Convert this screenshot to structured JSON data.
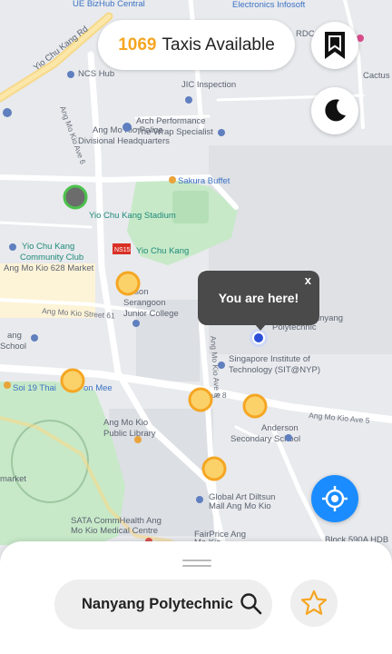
{
  "header": {
    "taxi_count": "1069",
    "taxi_label": "Taxis Available"
  },
  "map": {
    "labels": {
      "bizhub": "UE BizHub Central",
      "electronics": "Electronics Infosoft",
      "yio_chu_kang_rd": "Yio Chu Kang Rd",
      "rdc": "RDC-R",
      "ncs_hub": "NCS Hub",
      "jic": "JIC Inspection",
      "cactus": "Cactus Dr",
      "ang_mo_kio_ave_6": "Ang Mo Kio Ave 6",
      "arch_perf_1": "Arch Performance",
      "arch_perf_2": "The Wrap Specialist",
      "police_1": "Ang Mo Kio Police",
      "police_2": "Divisional Headquarters",
      "sakura": "Sakura Buffet",
      "stadium": "Yio Chu Kang Stadium",
      "cc_1": "Yio Chu Kang",
      "cc_2": "Community Club",
      "mrt_code": "NS15",
      "mrt_name": "Yio Chu Kang",
      "market_628": "Ang Mo Kio 628 Market",
      "serangoon_1": "rson",
      "serangoon_2": "Serangoon",
      "serangoon_3": "Junior College",
      "street_61": "Ang Mo Kio Street 61",
      "school_1": "ang",
      "school_2": "School",
      "nanyang_1": "Nanyang",
      "nanyang_2": "Polytechnic",
      "ave_8": "Ang Mo Kio Ave 8",
      "sit_1": "Singapore Institute of",
      "sit_2": "Technology (SIT@NYP)",
      "soi19_1": "Soi 19 Thai",
      "soi19_2": "on Mee",
      "ave8_short": "ue 8",
      "ave5": "Ang Mo Kio Ave 5",
      "anderson_1": "Anderson",
      "anderson_2": "Secondary School",
      "library_1": "Ang Mo Kio",
      "library_2": "Public Library",
      "market_left": "market",
      "global_1": "Global Art Diltsun",
      "global_2": "Mall Ang Mo Kio",
      "sata_1": "SATA CommHealth Ang",
      "sata_2": "Mo Kio Medical Centre",
      "fairprice_1": "FairPrice Ang",
      "fairprice_2": "Mo Kio",
      "block_590": "Block 590A HDB"
    }
  },
  "location_bubble": {
    "text": "You are here!",
    "close": "x"
  },
  "bottom_sheet": {
    "search_value": "Nanyang Polytechnic"
  },
  "colors": {
    "accent": "#f5a623",
    "user_dot": "#2c4fd8",
    "locate_button": "#1a8cff",
    "park": "#c7e9c8",
    "green_marker": "#4cc24c"
  },
  "icons": {
    "bookmark": "bookmark-icon",
    "theme": "moon-icon",
    "locate": "crosshair-icon",
    "search": "search-icon",
    "favorite": "star-icon"
  }
}
